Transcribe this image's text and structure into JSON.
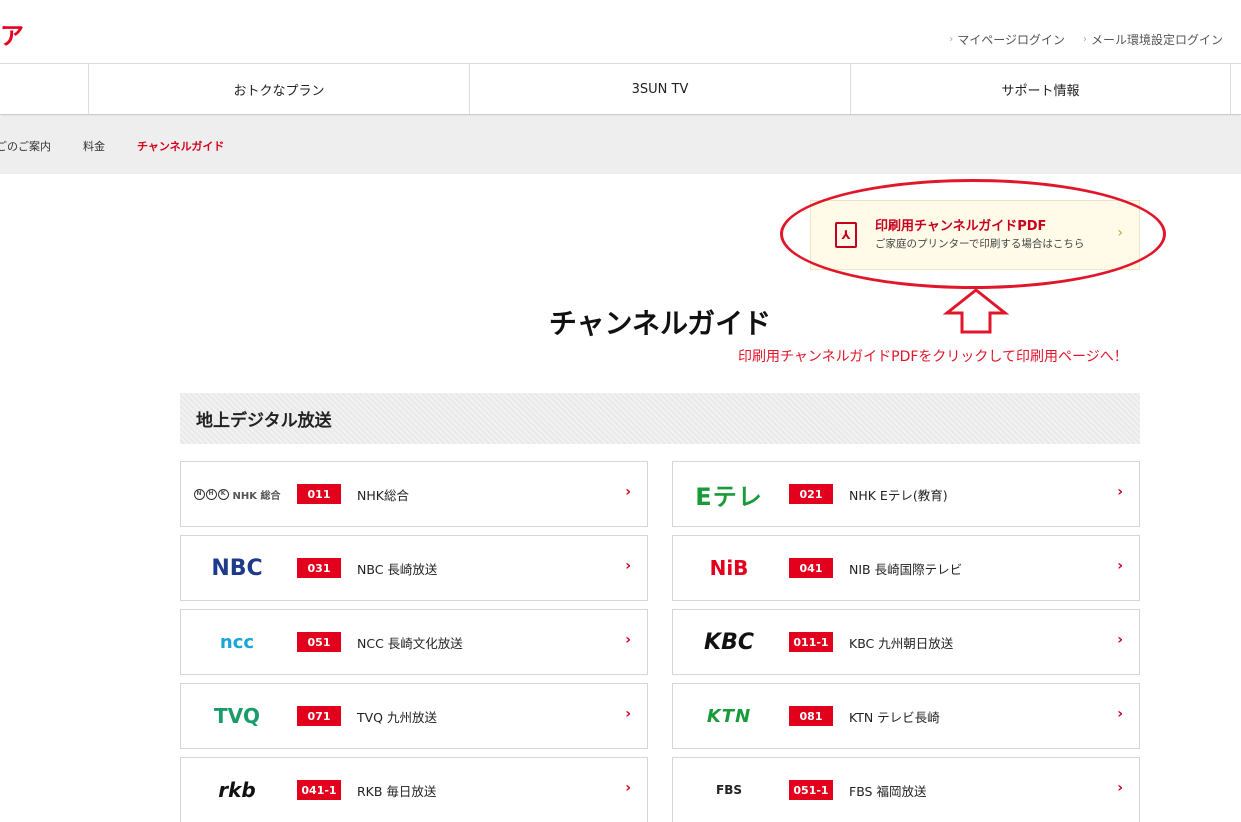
{
  "header": {
    "logo_text": "ア",
    "links": [
      "マイページログイン",
      "メール環境設定ログイン"
    ]
  },
  "gnav": {
    "items": [
      "おトクなプラン",
      "3SUN TV",
      "サポート情報"
    ]
  },
  "subnav": {
    "items": [
      "ごのご案内",
      "料金",
      "チャンネルガイド"
    ],
    "active_index": 2
  },
  "pdf": {
    "title": "印刷用チャンネルガイドPDF",
    "subtitle": "ご家庭のプリンターで印刷する場合はこちら"
  },
  "annotation": {
    "note": "印刷用チャンネルガイドPDFをクリックして印刷用ページへ！",
    "color": "#e2162a"
  },
  "page_title": "チャンネルガイド",
  "section": {
    "title": "地上デジタル放送"
  },
  "channels": [
    {
      "logo": "NHK 総合",
      "number": "011",
      "name": "NHK総合"
    },
    {
      "logo": "Eテレ",
      "number": "021",
      "name": "NHK Eテレ(教育)"
    },
    {
      "logo": "NBC",
      "number": "031",
      "name": "NBC 長崎放送"
    },
    {
      "logo": "NiB",
      "number": "041",
      "name": "NIB 長崎国際テレビ"
    },
    {
      "logo": "ncc",
      "number": "051",
      "name": "NCC 長崎文化放送"
    },
    {
      "logo": "KBC",
      "number": "011-1",
      "name": "KBC 九州朝日放送"
    },
    {
      "logo": "TVQ",
      "number": "071",
      "name": "TVQ 九州放送"
    },
    {
      "logo": "KTN",
      "number": "081",
      "name": "KTN テレビ長崎"
    },
    {
      "logo": "rkb",
      "number": "041-1",
      "name": "RKB 毎日放送"
    },
    {
      "logo": "FBS",
      "number": "051-1",
      "name": "FBS 福岡放送"
    }
  ],
  "colors": {
    "brand": "#e2001d",
    "link_active": "#d4001c"
  }
}
